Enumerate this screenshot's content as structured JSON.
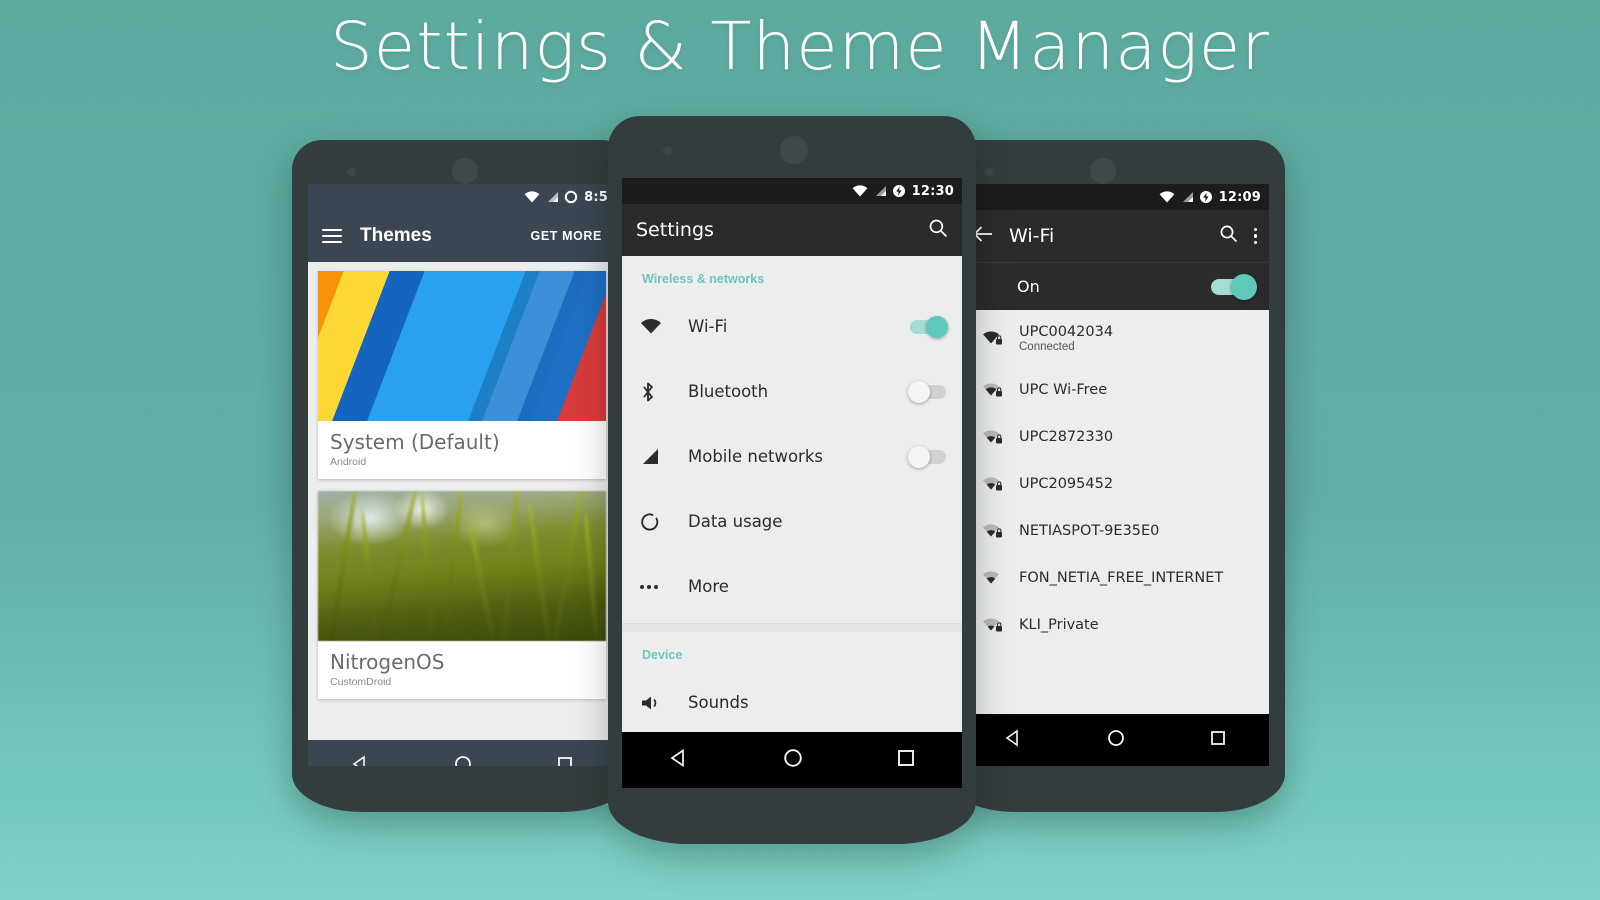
{
  "banner": {
    "title": "Settings & Theme Manager",
    "background_color": "#5fada5"
  },
  "colors": {
    "accent_teal": "#5fc8bb",
    "section_header": "#6fc6bb",
    "toolbar_dark": "#2b2b2b",
    "toolbar_blue": "#3b4652",
    "phone_body": "#343d3d"
  },
  "phones": {
    "left": {
      "status": {
        "time": "8:5",
        "icons": [
          "wifi-icon",
          "signal-icon",
          "battery-icon"
        ]
      },
      "toolbar": {
        "menu_icon": "hamburger-icon",
        "title": "Themes",
        "action_label": "GET MORE"
      },
      "themes": [
        {
          "name": "System (Default)",
          "author": "Android",
          "thumb": "material-stripes"
        },
        {
          "name": "NitrogenOS",
          "author": "CustomDroid",
          "thumb": "grass-photo"
        }
      ],
      "nav": {
        "back": "back-icon",
        "home": "home-icon",
        "recents": "recents-icon"
      }
    },
    "center": {
      "status": {
        "time": "12:30",
        "icons": [
          "wifi-icon",
          "signal-icon",
          "battery-charging-icon"
        ]
      },
      "toolbar": {
        "title": "Settings",
        "search_icon": "search-icon"
      },
      "sections": [
        {
          "header": "Wireless & networks",
          "items": [
            {
              "label": "Wi-Fi",
              "icon": "wifi-icon",
              "toggle": "on"
            },
            {
              "label": "Bluetooth",
              "icon": "bluetooth-icon",
              "toggle": "off"
            },
            {
              "label": "Mobile networks",
              "icon": "signal-icon",
              "toggle": "off"
            },
            {
              "label": "Data usage",
              "icon": "data-usage-icon",
              "toggle": "none"
            },
            {
              "label": "More",
              "icon": "more-icon",
              "toggle": "none"
            }
          ]
        },
        {
          "header": "Device",
          "items": [
            {
              "label": "Sounds",
              "icon": "volume-icon",
              "toggle": "none"
            }
          ]
        }
      ],
      "nav": {
        "back": "back-icon",
        "home": "home-icon",
        "recents": "recents-icon"
      }
    },
    "right": {
      "status": {
        "time": "12:09",
        "icons": [
          "wifi-icon",
          "signal-icon",
          "battery-charging-icon"
        ]
      },
      "toolbar": {
        "back_icon": "back-arrow-icon",
        "title": "Wi-Fi",
        "search_icon": "search-icon",
        "overflow_icon": "overflow-menu-icon"
      },
      "wifi_switch": {
        "label": "On",
        "state": "on"
      },
      "networks": [
        {
          "ssid": "UPC0042034",
          "status": "Connected",
          "signal": 4,
          "secured": true
        },
        {
          "ssid": "UPC Wi-Free",
          "status": "",
          "signal": 3,
          "secured": true
        },
        {
          "ssid": "UPC2872330",
          "status": "",
          "signal": 2,
          "secured": true
        },
        {
          "ssid": "UPC2095452",
          "status": "",
          "signal": 2,
          "secured": true
        },
        {
          "ssid": "NETIASPOT-9E35E0",
          "status": "",
          "signal": 2,
          "secured": true
        },
        {
          "ssid": "FON_NETIA_FREE_INTERNET",
          "status": "",
          "signal": 2,
          "secured": false
        },
        {
          "ssid": "KLI_Private",
          "status": "",
          "signal": 1,
          "secured": true
        }
      ],
      "nav": {
        "back": "back-icon",
        "home": "home-icon",
        "recents": "recents-icon"
      }
    }
  }
}
